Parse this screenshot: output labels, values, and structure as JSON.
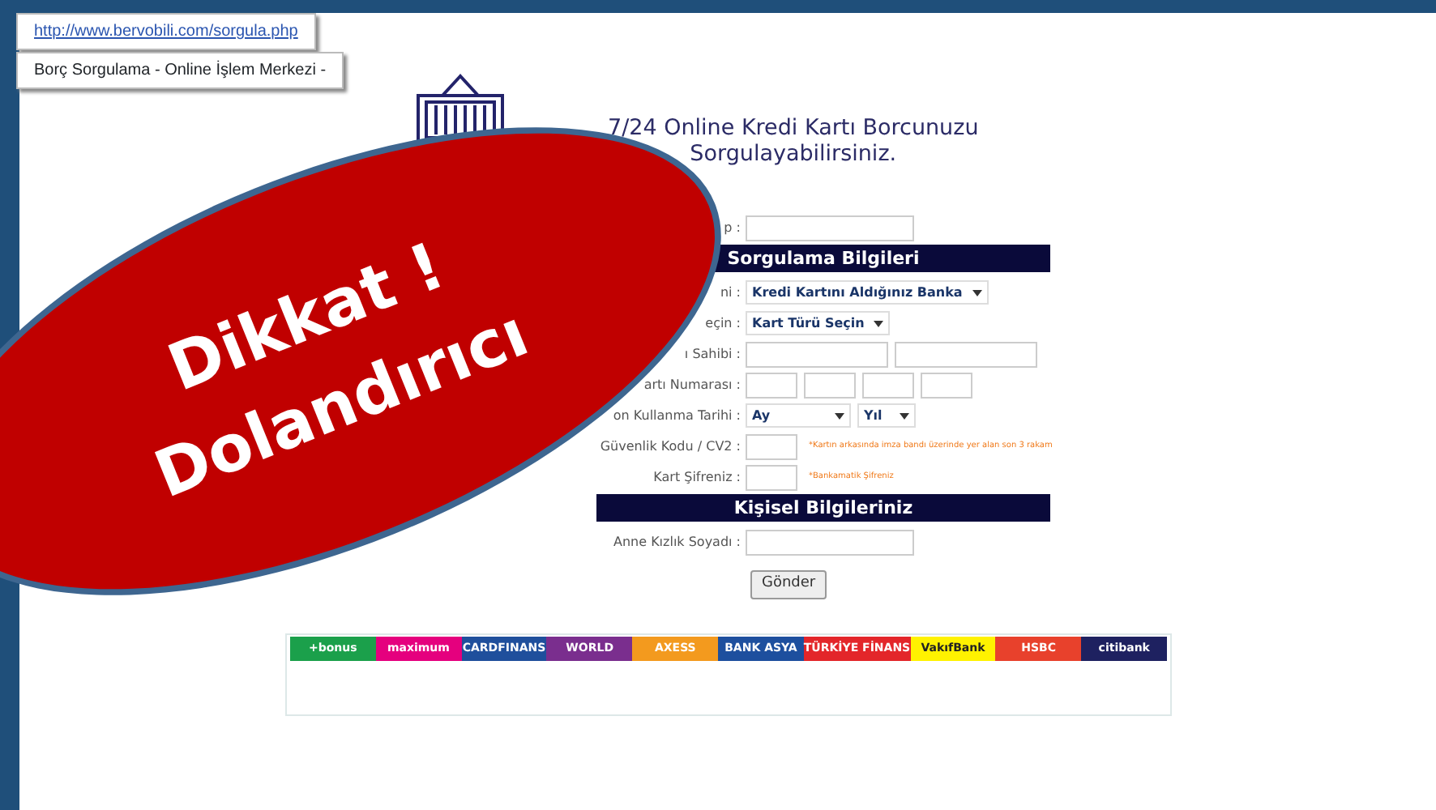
{
  "browser_popups": [
    {
      "kind": "link",
      "text": "http://www.bervobili.com/sorgula.php"
    },
    {
      "kind": "title",
      "text": "Borç Sorgulama - Online İşlem Merkezi -"
    }
  ],
  "heading": [
    "7/24 Online Kredi Kartı Borcunuzu",
    "Sorgulayabilirsiniz."
  ],
  "form": [
    {
      "kind": "row",
      "label": "p :",
      "fields": [
        {
          "kind": "input"
        }
      ]
    },
    {
      "kind": "header",
      "title": "Sorgulama Bilgileri"
    },
    {
      "kind": "row",
      "label": "ni :",
      "fields": [
        {
          "kind": "select",
          "value": "Kredi Kartını Aldığınız Banka"
        }
      ]
    },
    {
      "kind": "row",
      "label": "eçin :",
      "fields": [
        {
          "kind": "select",
          "value": "Kart Türü Seçin"
        }
      ]
    },
    {
      "kind": "row",
      "label": "ı Sahibi :",
      "fields": [
        {
          "kind": "input"
        },
        {
          "kind": "input"
        }
      ]
    },
    {
      "kind": "row",
      "label": "artı Numarası :",
      "fields": [
        {
          "kind": "input"
        },
        {
          "kind": "input"
        },
        {
          "kind": "input"
        },
        {
          "kind": "input"
        }
      ]
    },
    {
      "kind": "row",
      "label": "on Kullanma Tarihi :",
      "fields": [
        {
          "kind": "select",
          "value": "Ay"
        },
        {
          "kind": "select",
          "value": "Yıl"
        }
      ]
    },
    {
      "kind": "row",
      "label": "Güvenlik Kodu / CV2 :",
      "fields": [
        {
          "kind": "input"
        }
      ],
      "hint": "*Kartın arkasında imza bandı üzerinde yer alan son 3 rakam"
    },
    {
      "kind": "row",
      "label": "Kart Şifreniz :",
      "fields": [
        {
          "kind": "input"
        }
      ],
      "hint": "*Bankamatik Şifreniz"
    },
    {
      "kind": "header",
      "title": "Kişisel Bilgileriniz"
    },
    {
      "kind": "row",
      "label": "Anne Kızlık Soyadı :",
      "fields": [
        {
          "kind": "input"
        }
      ]
    },
    {
      "kind": "submit",
      "label": "Gönder"
    }
  ],
  "bank_logos": [
    {
      "label": "+bonus",
      "color": "#1ba04b"
    },
    {
      "label": "maximum",
      "color": "#e5007e"
    },
    {
      "label": "CARDFINANS",
      "color": "#1f4f9c"
    },
    {
      "label": "WORLD",
      "color": "#7a2e8e"
    },
    {
      "label": "AXESS",
      "color": "#f39a1e"
    },
    {
      "label": "BANK ASYA",
      "color": "#1d4f9e"
    },
    {
      "label": "TÜRKİYE FİNANS",
      "color": "#e3262a"
    },
    {
      "label": "VakıfBank",
      "color": "#fff200"
    },
    {
      "label": "HSBC",
      "color": "#e8412c"
    },
    {
      "label": "citibank",
      "color": "#1e2160"
    }
  ],
  "warning": {
    "lines": [
      "Dikkat !",
      "Dolandırıcı"
    ]
  }
}
